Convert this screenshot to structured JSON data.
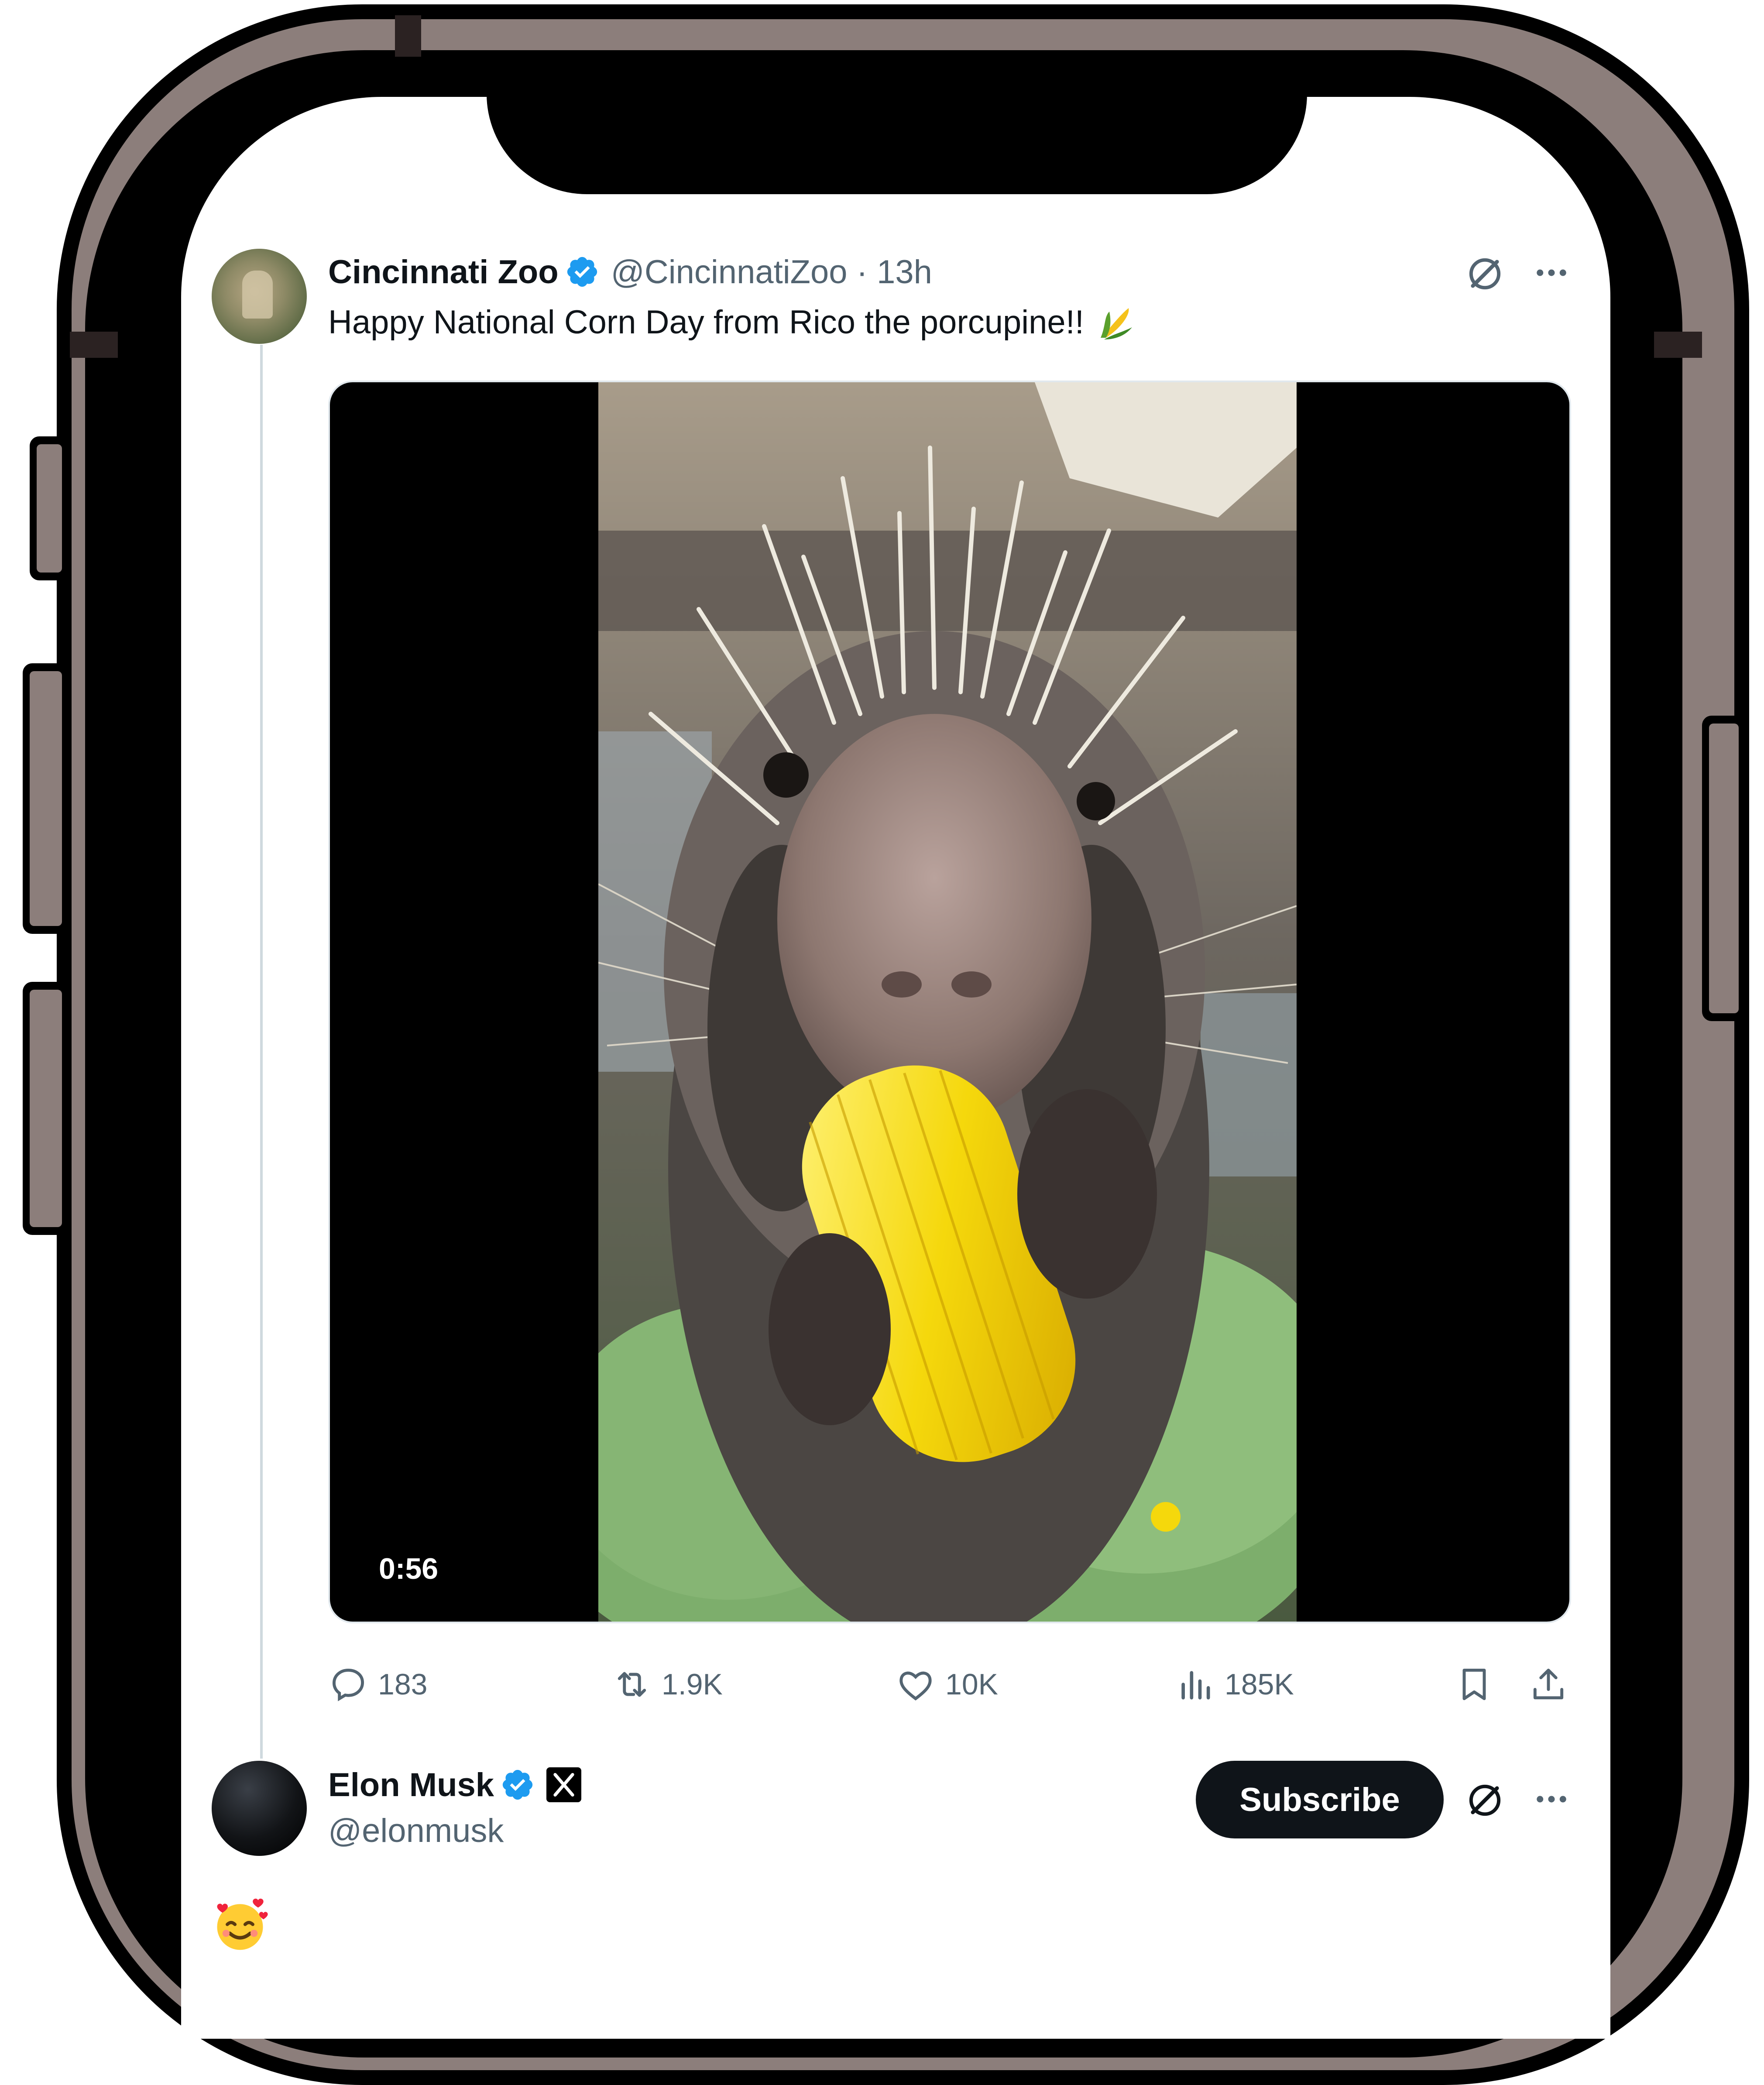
{
  "tweet_1": {
    "author_name": "Cincinnati Zoo",
    "author_handle": "@CincinnatiZoo · 13h",
    "text": "Happy National Corn Day from Rico the porcupine!!",
    "video_duration": "0:56",
    "media_description_icon": "porcupine-eating-corn-video",
    "stats": {
      "replies": "183",
      "reposts": "1.9K",
      "likes": "10K",
      "views": "185K"
    }
  },
  "tweet_2": {
    "author_name": "Elon Musk",
    "author_handle": "@elonmusk",
    "subscribe_label": "Subscribe",
    "reply_emoji_icon": "smiling-face-with-hearts-emoji"
  },
  "colors": {
    "verified_blue": "#1d9bf0",
    "text_primary": "#0f1419",
    "text_secondary": "#536471",
    "frame_gray": "#8c7e7b"
  }
}
